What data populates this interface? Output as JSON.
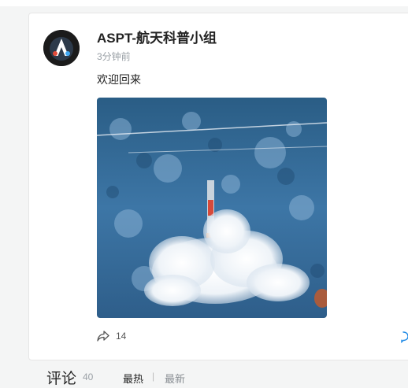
{
  "post": {
    "author": "ASPT-航天科普小组",
    "time": "3分钟前",
    "text": "欢迎回来",
    "share_count": "14"
  },
  "comments": {
    "title": "评论",
    "count": "40",
    "sort_hot": "最热",
    "sort_separator": "|",
    "sort_new": "最新"
  },
  "colors": {
    "accent": "#1f8ae6",
    "text_primary": "#222222",
    "text_secondary": "#9aa0a6"
  },
  "icons": {
    "avatar": "astronaut-logo",
    "share": "share-icon",
    "comment": "comment-icon"
  }
}
